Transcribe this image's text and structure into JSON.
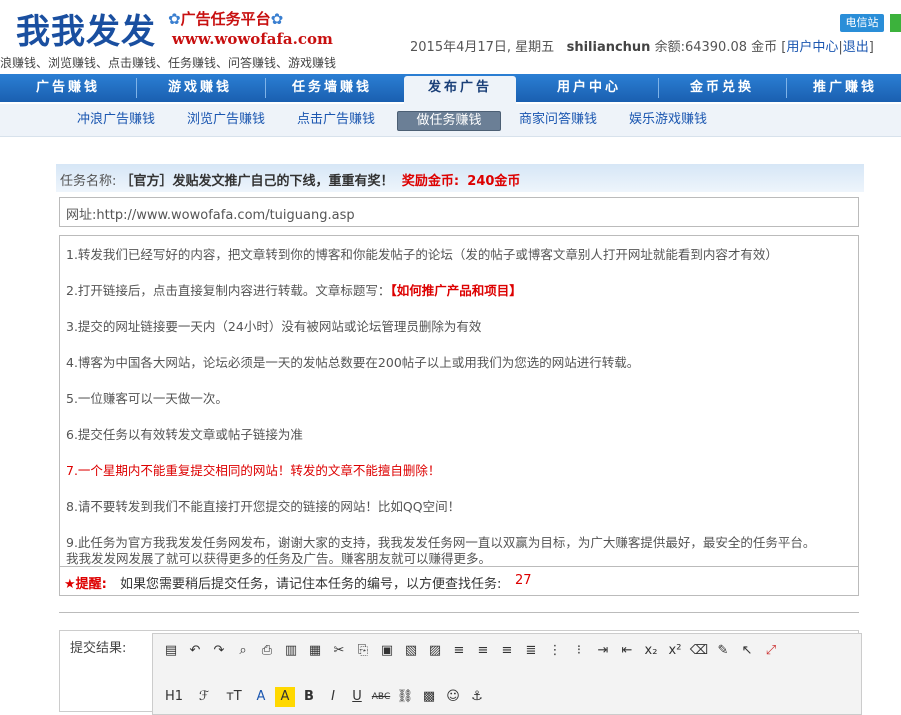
{
  "header": {
    "logo_text": "我我发发",
    "logo_subtitle": "广告任务平台",
    "logo_url": "www.wowofafa.com",
    "tagline": "浪赚钱、浏览赚钱、点击赚钱、任务赚钱、问答赚钱、游戏赚钱",
    "date": "2015年4月17日, 星期五",
    "username": "shilianchun",
    "balance": "余额:64390.08 金币",
    "user_center": "用户中心",
    "logout": "退出",
    "tel_btn": "电信站"
  },
  "nav": {
    "items": [
      "广告赚钱",
      "游戏赚钱",
      "任务墙赚钱",
      "发布广告",
      "用户中心",
      "金币兑换",
      "推广赚钱"
    ],
    "active_index": 3
  },
  "subnav": {
    "items": [
      "冲浪广告赚钱",
      "浏览广告赚钱",
      "点击广告赚钱",
      "做任务赚钱",
      "商家问答赚钱",
      "娱乐游戏赚钱"
    ],
    "active_index": 3
  },
  "task": {
    "name_label": "任务名称:",
    "name": "［官方］发贴发文推广自己的下线，重重有奖！",
    "reward_label": "奖励金币:",
    "reward": "240金币",
    "url": "网址:http://www.wowofafa.com/tuiguang.asp"
  },
  "rules": {
    "r1": "1.转发我们已经写好的内容，把文章转到你的博客和你能发帖子的论坛（发的帖子或博客文章别人打开网址就能看到内容才有效）",
    "r2_prefix": "2.打开链接后，点击直接复制内容进行转载。文章标题写：",
    "r2_title": "【如何推广产品和项目】",
    "r3": "3.提交的网址链接要一天内（24小时）没有被网站或论坛管理员删除为有效",
    "r4": "4.博客为中国各大网站，论坛必须是一天的发帖总数要在200帖子以上或用我们为您选的网站进行转载。",
    "r5": "5.一位赚客可以一天做一次。",
    "r6": "6.提交任务以有效转发文章或帖子链接为准",
    "r7": "7.一个星期内不能重复提交相同的网站！转发的文章不能擅自删除！",
    "r8": "8.请不要转发到我们不能直接打开您提交的链接的网站！比如QQ空间！",
    "r9_line1": "9.此任务为官方我我发发任务网发布，谢谢大家的支持，我我发发任务网一直以双赢为目标，为广大赚客提供最好，最安全的任务平台。",
    "r9_line2": "我我发发网发展了就可以获得更多的任务及广告。赚客朋友就可以赚得更多。"
  },
  "note": {
    "label": "★提醒:",
    "text": "如果您需要稍后提交任务，请记住本任务的编号，以方便查找任务:",
    "task_id": "27"
  },
  "submit": {
    "label": "提交结果:"
  },
  "editor": {
    "row2_labels": [
      "H1",
      "ℱ",
      "тT",
      "A",
      "A",
      "B",
      "I",
      "U",
      "ABC"
    ]
  },
  "colors": {
    "nav_blue": "#1a5fb0",
    "accent_red": "#dd0000",
    "link_blue": "#1a56b0"
  }
}
